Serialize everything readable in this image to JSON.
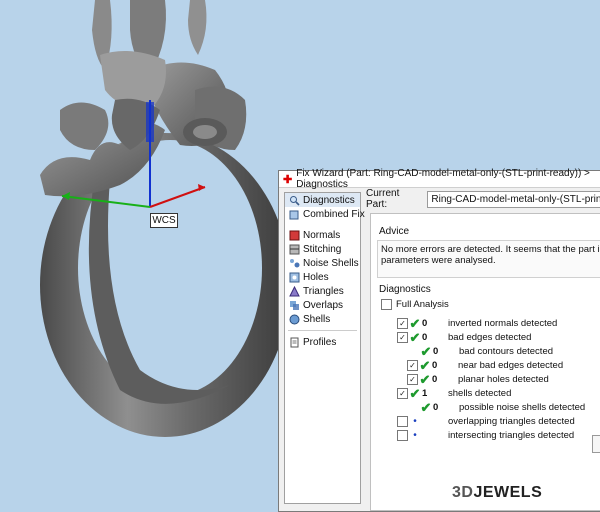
{
  "window": {
    "title": "Fix Wizard (Part: Ring-CAD-model-metal-only-(STL-print-ready)) > Diagnostics",
    "title_icon": "cross-icon"
  },
  "viewport": {
    "wcs_label": "WCS",
    "axis_colors": {
      "x": "#d01010",
      "y": "#18b018",
      "z": "#1030d0"
    }
  },
  "nav": {
    "items": [
      {
        "label": "Diagnostics",
        "icon": "magnifier-icon",
        "selected": true
      },
      {
        "label": "Combined Fix",
        "icon": "cube-icon"
      },
      {
        "label": "Normals",
        "icon": "normals-icon"
      },
      {
        "label": "Stitching",
        "icon": "stitching-icon"
      },
      {
        "label": "Noise Shells",
        "icon": "noise-shells-icon"
      },
      {
        "label": "Holes",
        "icon": "holes-icon"
      },
      {
        "label": "Triangles",
        "icon": "triangles-icon"
      },
      {
        "label": "Overlaps",
        "icon": "overlaps-icon"
      },
      {
        "label": "Shells",
        "icon": "shells-icon"
      },
      {
        "label": "Profiles",
        "icon": "profiles-icon"
      }
    ]
  },
  "current_part": {
    "label": "Current Part:",
    "value": "Ring-CAD-model-metal-only-(STL-print-ready)"
  },
  "advice": {
    "title": "Advice",
    "line1": "No more errors are detected. It seems that the part is ok. Note t",
    "line2": "parameters were analysed."
  },
  "diagnostics": {
    "title": "Diagnostics",
    "full_analysis": "Full Analysis",
    "rows": [
      {
        "label": "inverted normals detected",
        "count": "0",
        "status": "ok",
        "checked": true
      },
      {
        "label": "bad edges detected",
        "count": "0",
        "status": "ok",
        "checked": true
      },
      {
        "label": "bad contours detected",
        "count": "0",
        "status": "ok",
        "checked": false
      },
      {
        "label": "near bad edges detected",
        "count": "0",
        "status": "ok",
        "checked": true
      },
      {
        "label": "planar holes detected",
        "count": "0",
        "status": "ok",
        "checked": true
      },
      {
        "label": "shells detected",
        "count": "1",
        "status": "ok",
        "checked": true
      },
      {
        "label": "possible noise shells detected",
        "count": "0",
        "status": "ok",
        "checked": false
      },
      {
        "label": "overlapping triangles detected",
        "count": "",
        "status": "pending",
        "checked": false
      },
      {
        "label": "intersecting triangles detected",
        "count": "",
        "status": "pending",
        "checked": false
      }
    ]
  },
  "logo": {
    "part1": "3D",
    "part2": "JEWELS"
  }
}
